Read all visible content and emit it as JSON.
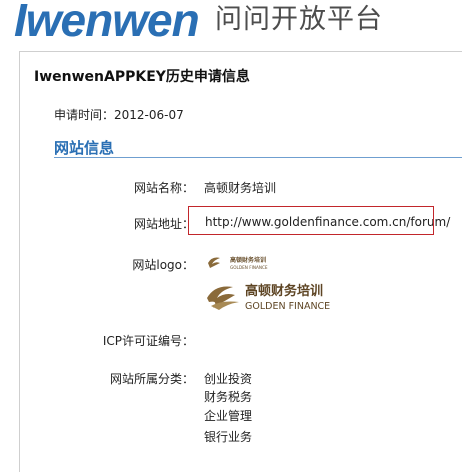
{
  "header": {
    "brand": "Iwenwen",
    "tagline": "问问开放平台"
  },
  "panel": {
    "title": "IwenwenAPPKEY历史申请信息",
    "apply_time_label": "申请时间：",
    "apply_time_value": "2012-06-07",
    "section_title": "网站信息"
  },
  "site": {
    "name_label": "网站名称：",
    "name_value": "高顿财务培训",
    "url_label": "网站地址：",
    "url_value": "http://www.goldenfinance.com.cn/forum/",
    "logo_label": "网站logo：",
    "icp_label": "ICP许可证编号：",
    "icp_value": "",
    "category_label": "网站所属分类：",
    "categories": [
      "创业投资",
      "财务税务",
      "企业管理",
      "银行业务"
    ]
  },
  "logo": {
    "cn_text": "高顿财务培训",
    "en_text": "GOLDEN FINANCE",
    "color": "#8a6a3a"
  },
  "colors": {
    "brand_blue": "#2a6fb4",
    "highlight_red": "#c2262b"
  }
}
